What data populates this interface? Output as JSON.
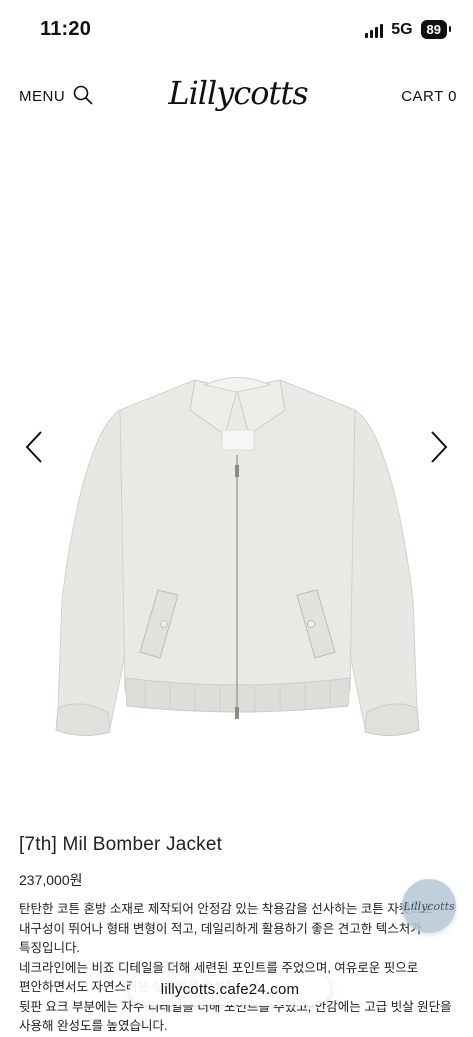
{
  "status_bar": {
    "time": "11:20",
    "network": "5G",
    "battery": "89"
  },
  "header": {
    "menu_label": "MENU",
    "logo_text": "Lillycotts",
    "cart_label": "CART 0"
  },
  "product": {
    "name": "[7th] Mil Bomber Jacket",
    "price": "237,000원",
    "description": [
      "탄탄한 코튼 혼방 소재로 제작되어 안정감 있는 착용감을 선사하는 코튼 자켓으로 내구성이 뛰어나 형태 변형이 적고, 데일리하게 활용하기 좋은 견고한 텍스처가 특징입니다.",
      "네크라인에는 비죠 디테일을 더해 세련된 포인트를 주었으며, 여유로운 핏으로 편안하면서도 자연스러운 실루엣을 완성합니다.",
      "뒷판 요크 부분에는 자수 디테일을 더해 포인트를 주었고, 안감에는 고급 빗살 원단을 사용해 완성도를 높였습니다."
    ]
  },
  "browser": {
    "url": "lillycotts.cafe24.com"
  },
  "chat": {
    "label": "Lillycotts"
  },
  "colors": {
    "jacket": "#e6e8e4",
    "jacket_shadow": "#c9ccc8",
    "chat_button": "#b7c7d8"
  },
  "icons": {
    "search": "search-icon",
    "prev": "chevron-left-icon",
    "next": "chevron-right-icon"
  }
}
